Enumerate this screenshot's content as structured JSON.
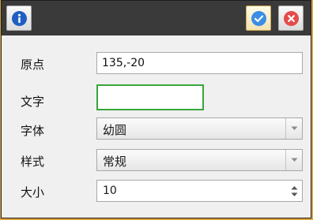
{
  "titlebar": {
    "info_icon": "info-icon",
    "ok_icon": "checkmark-icon",
    "cancel_icon": "close-icon",
    "colors": {
      "bar": "#3a3a3a",
      "ok": "#3a8ee6",
      "cancel": "#e44b4b",
      "info": "#1f5fc2"
    }
  },
  "form": {
    "origin": {
      "label": "原点",
      "value": "135,-20"
    },
    "text": {
      "label": "文字",
      "value": ""
    },
    "font": {
      "label": "字体",
      "value": "幼圆"
    },
    "style": {
      "label": "样式",
      "value": "常规"
    },
    "size": {
      "label": "大小",
      "value": "10"
    }
  },
  "focus_color": "#37a63b"
}
